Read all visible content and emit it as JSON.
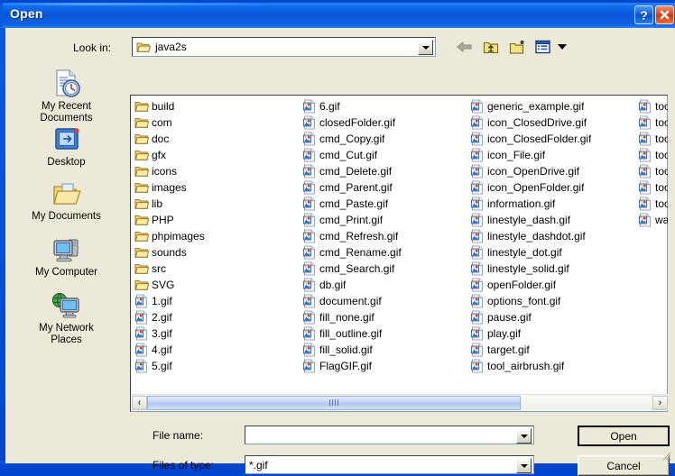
{
  "window": {
    "title": "Open",
    "help_button": "?",
    "close_button": "X"
  },
  "lookin": {
    "label": "Look in:",
    "value": "java2s",
    "icon": "open-folder-icon"
  },
  "toolbar": {
    "back": "back-arrow-icon",
    "up": "up-one-level-icon",
    "new_folder": "new-folder-icon",
    "views": "views-menu-icon"
  },
  "places": [
    {
      "label1": "My Recent",
      "label2": "Documents",
      "icon": "recent-documents-icon"
    },
    {
      "label1": "Desktop",
      "label2": "",
      "icon": "desktop-icon"
    },
    {
      "label1": "My Documents",
      "label2": "",
      "icon": "my-documents-icon"
    },
    {
      "label1": "My Computer",
      "label2": "",
      "icon": "my-computer-icon"
    },
    {
      "label1": "My Network",
      "label2": "Places",
      "icon": "network-places-icon"
    }
  ],
  "filelist": {
    "columns": [
      {
        "items": [
          {
            "name": "build",
            "type": "folder"
          },
          {
            "name": "com",
            "type": "folder"
          },
          {
            "name": "doc",
            "type": "folder"
          },
          {
            "name": "gfx",
            "type": "folder"
          },
          {
            "name": "icons",
            "type": "folder"
          },
          {
            "name": "images",
            "type": "folder"
          },
          {
            "name": "lib",
            "type": "folder"
          },
          {
            "name": "PHP",
            "type": "folder"
          },
          {
            "name": "phpimages",
            "type": "folder"
          },
          {
            "name": "sounds",
            "type": "folder"
          },
          {
            "name": "src",
            "type": "folder"
          },
          {
            "name": "SVG",
            "type": "folder"
          },
          {
            "name": "1.gif",
            "type": "gif"
          },
          {
            "name": "2.gif",
            "type": "gif"
          },
          {
            "name": "3.gif",
            "type": "gif"
          },
          {
            "name": "4.gif",
            "type": "gif"
          },
          {
            "name": "5.gif",
            "type": "gif"
          }
        ]
      },
      {
        "items": [
          {
            "name": "6.gif",
            "type": "gif"
          },
          {
            "name": "closedFolder.gif",
            "type": "gif"
          },
          {
            "name": "cmd_Copy.gif",
            "type": "gif"
          },
          {
            "name": "cmd_Cut.gif",
            "type": "gif"
          },
          {
            "name": "cmd_Delete.gif",
            "type": "gif"
          },
          {
            "name": "cmd_Parent.gif",
            "type": "gif"
          },
          {
            "name": "cmd_Paste.gif",
            "type": "gif"
          },
          {
            "name": "cmd_Print.gif",
            "type": "gif"
          },
          {
            "name": "cmd_Refresh.gif",
            "type": "gif"
          },
          {
            "name": "cmd_Rename.gif",
            "type": "gif"
          },
          {
            "name": "cmd_Search.gif",
            "type": "gif"
          },
          {
            "name": "db.gif",
            "type": "gif"
          },
          {
            "name": "document.gif",
            "type": "gif"
          },
          {
            "name": "fill_none.gif",
            "type": "gif"
          },
          {
            "name": "fill_outline.gif",
            "type": "gif"
          },
          {
            "name": "fill_solid.gif",
            "type": "gif"
          },
          {
            "name": "FlagGIF.gif",
            "type": "gif"
          }
        ]
      },
      {
        "items": [
          {
            "name": "generic_example.gif",
            "type": "gif"
          },
          {
            "name": "icon_ClosedDrive.gif",
            "type": "gif"
          },
          {
            "name": "icon_ClosedFolder.gif",
            "type": "gif"
          },
          {
            "name": "icon_File.gif",
            "type": "gif"
          },
          {
            "name": "icon_OpenDrive.gif",
            "type": "gif"
          },
          {
            "name": "icon_OpenFolder.gif",
            "type": "gif"
          },
          {
            "name": "information.gif",
            "type": "gif"
          },
          {
            "name": "linestyle_dash.gif",
            "type": "gif"
          },
          {
            "name": "linestyle_dashdot.gif",
            "type": "gif"
          },
          {
            "name": "linestyle_dot.gif",
            "type": "gif"
          },
          {
            "name": "linestyle_solid.gif",
            "type": "gif"
          },
          {
            "name": "openFolder.gif",
            "type": "gif"
          },
          {
            "name": "options_font.gif",
            "type": "gif"
          },
          {
            "name": "pause.gif",
            "type": "gif"
          },
          {
            "name": "play.gif",
            "type": "gif"
          },
          {
            "name": "target.gif",
            "type": "gif"
          },
          {
            "name": "tool_airbrush.gif",
            "type": "gif"
          }
        ]
      },
      {
        "clipped": true,
        "items": [
          {
            "name": "tool",
            "type": "gif"
          },
          {
            "name": "tool",
            "type": "gif"
          },
          {
            "name": "tool",
            "type": "gif"
          },
          {
            "name": "tool",
            "type": "gif"
          },
          {
            "name": "tool",
            "type": "gif"
          },
          {
            "name": "tool",
            "type": "gif"
          },
          {
            "name": "tool",
            "type": "gif"
          },
          {
            "name": "warn",
            "type": "gif"
          }
        ]
      }
    ],
    "scrollbar": {
      "left_arrow": "‹",
      "right_arrow": "›"
    }
  },
  "fields": {
    "filename_label": "File name:",
    "filename_value": "",
    "filetype_label": "Files of type:",
    "filetype_value": "*.gif"
  },
  "buttons": {
    "open": "Open",
    "cancel": "Cancel"
  },
  "colors": {
    "title_blue": "#0a55d8",
    "dialog_face": "#ece9d8",
    "folder_yellow": "#f8dc8c",
    "close_red": "#d8380f",
    "list_bg": "#ffffff"
  }
}
